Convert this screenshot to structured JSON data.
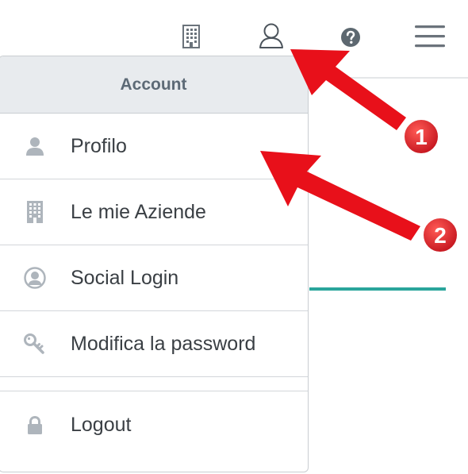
{
  "topbar": {
    "icons": [
      "building-icon",
      "user-icon",
      "help-icon",
      "hamburger-menu-icon"
    ]
  },
  "dropdown": {
    "header": "Account",
    "items": [
      {
        "label": "Profilo",
        "icon": "user-icon"
      },
      {
        "label": "Le mie Aziende",
        "icon": "building-icon"
      },
      {
        "label": "Social Login",
        "icon": "user-circle-icon"
      },
      {
        "label": "Modifica la password",
        "icon": "key-icon"
      }
    ],
    "logout": {
      "label": "Logout",
      "icon": "lock-icon"
    }
  },
  "annotations": [
    {
      "number": "1"
    },
    {
      "number": "2"
    }
  ],
  "colors": {
    "accent_teal": "#2aa59b",
    "arrow_red": "#e8101a",
    "icon_gray": "#aeb5bc",
    "header_bg": "#e8ebee"
  }
}
